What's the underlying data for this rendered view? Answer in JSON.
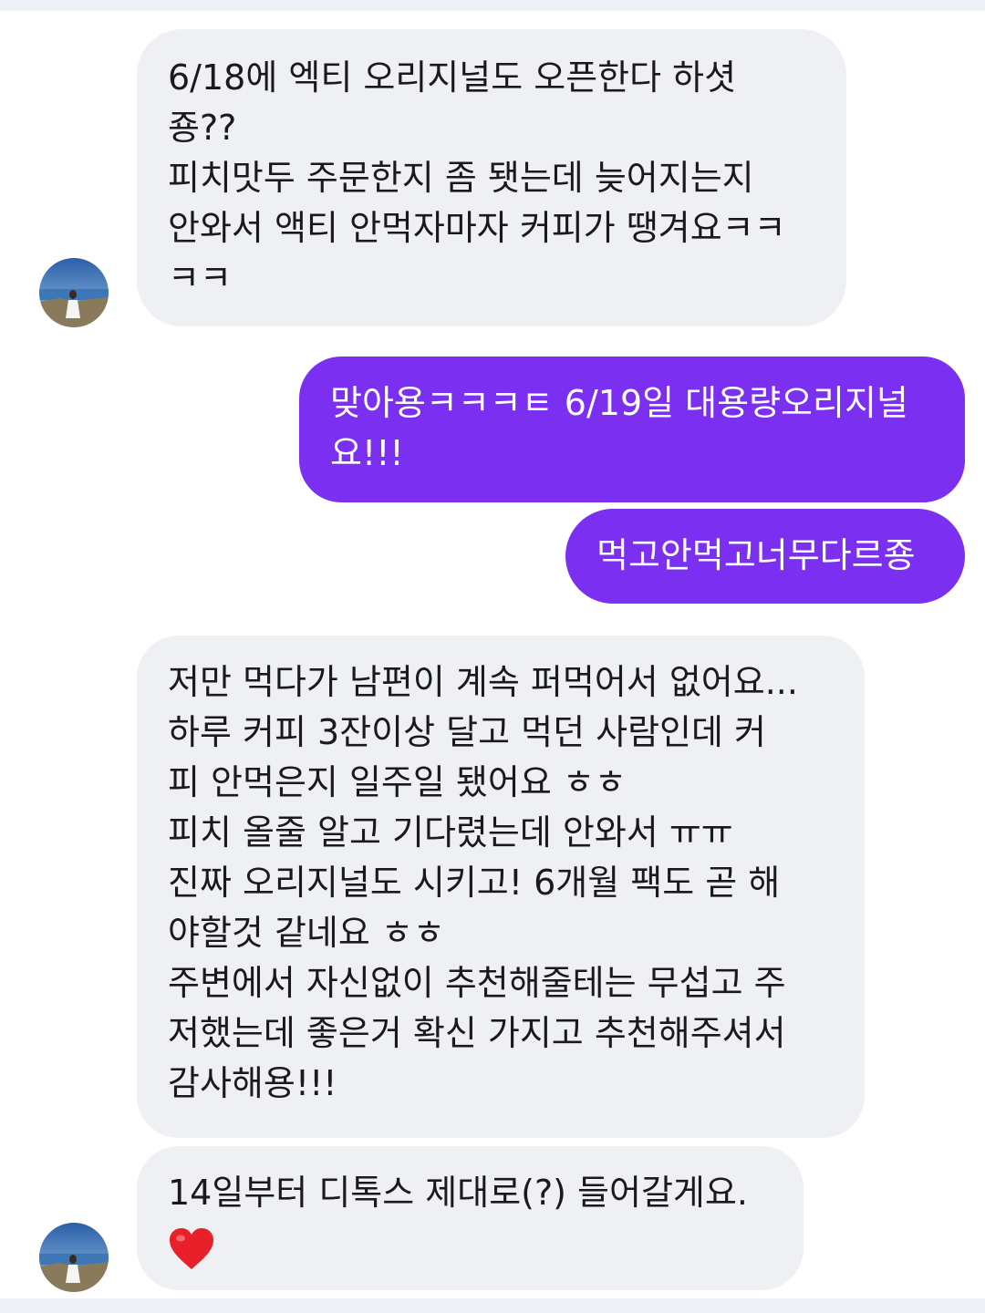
{
  "messages": [
    {
      "sender": "them",
      "text": "6/18에 엑티 오리지널도 오픈한다 하셧\n죵??\n피치맛두 주문한지 좀 됏는데 늦어지는지\n안와서 액티 안먹자마자 커피가 땡겨요ㅋㅋ\nㅋㅋ"
    },
    {
      "sender": "me",
      "text": "맞아용ㅋㅋㅋㅌ 6/19일 대용량오리지널\n요!!!"
    },
    {
      "sender": "me",
      "text": "먹고안먹고너무다르죵"
    },
    {
      "sender": "them",
      "text": "저만 먹다가 남편이 계속 퍼먹어서 없어요...\n하루 커피 3잔이상 달고 먹던 사람인데 커\n피 안먹은지 일주일 됐어요 ㅎㅎ\n피치 올줄 알고 기다렸는데 안와서 ㅠㅠ\n진짜 오리지널도 시키고! 6개월 팩도 곧 해\n야할것 같네요 ㅎㅎ\n주변에서 자신없이 추천해줄테는 무섭고 주\n저했는데 좋은거 확신 가지고 추천해주셔서\n감사해용!!!"
    },
    {
      "sender": "them",
      "text": "14일부터 디톡스 제대로(?) 들어갈게요.",
      "emoji": "heart"
    }
  ],
  "colors": {
    "incoming_bubble": "#eef0f4",
    "outgoing_bubble": "#7b2ff0",
    "incoming_text": "#1a1a1a",
    "outgoing_text": "#ffffff",
    "heart": "#e8202a"
  },
  "icons": {
    "avatar": "profile-photo-avatar",
    "emoji": "red-heart-icon"
  }
}
